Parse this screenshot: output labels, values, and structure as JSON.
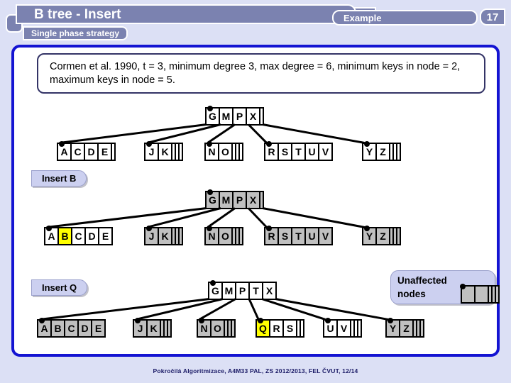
{
  "header": {
    "title": "B tree - Insert",
    "subtitle": "Single phase strategy",
    "section": "Example",
    "page_number": "17"
  },
  "callout": {
    "text": "Cormen et al. 1990, t = 3, minimum degree 3, max degree = 6, minimum keys in node = 2, maximum keys in node = 5."
  },
  "labels": {
    "insert_b": "Insert B",
    "insert_q": "Insert Q"
  },
  "legend": {
    "text": "Unaffected nodes"
  },
  "footer": {
    "text": "Pokročilá Algoritmizace, A4M33 PAL, ZS 2012/2013, FEL ČVUT,  12/14"
  },
  "colors": {
    "panel_border": "#1414d2",
    "header_fill": "#7b82b0",
    "page_bg": "#dce0f5",
    "highlight": "#ffff00",
    "unaffected": "#c0c0c0",
    "affected": "#ffffff"
  },
  "trees": [
    {
      "name": "initial-tree",
      "root": {
        "keys": [
          "G",
          "M",
          "P",
          "X"
        ],
        "capacity": 5,
        "fill": "white",
        "highlight": null
      },
      "children": [
        {
          "keys": [
            "A",
            "C",
            "D",
            "E"
          ],
          "capacity": 5,
          "fill": "white",
          "highlight": null
        },
        {
          "keys": [
            "J",
            "K"
          ],
          "capacity": 5,
          "fill": "white",
          "highlight": null
        },
        {
          "keys": [
            "N",
            "O"
          ],
          "capacity": 5,
          "fill": "white",
          "highlight": null
        },
        {
          "keys": [
            "R",
            "S",
            "T",
            "U",
            "V"
          ],
          "capacity": 5,
          "fill": "white",
          "highlight": null
        },
        {
          "keys": [
            "Y",
            "Z"
          ],
          "capacity": 5,
          "fill": "white",
          "highlight": null
        }
      ]
    },
    {
      "name": "after-insert-b",
      "root": {
        "keys": [
          "G",
          "M",
          "P",
          "X"
        ],
        "capacity": 5,
        "fill": "gray",
        "highlight": null
      },
      "children": [
        {
          "keys": [
            "A",
            "B",
            "C",
            "D",
            "E"
          ],
          "capacity": 5,
          "fill": "white",
          "highlight": "B"
        },
        {
          "keys": [
            "J",
            "K"
          ],
          "capacity": 5,
          "fill": "gray",
          "highlight": null
        },
        {
          "keys": [
            "N",
            "O"
          ],
          "capacity": 5,
          "fill": "gray",
          "highlight": null
        },
        {
          "keys": [
            "R",
            "S",
            "T",
            "U",
            "V"
          ],
          "capacity": 5,
          "fill": "gray",
          "highlight": null
        },
        {
          "keys": [
            "Y",
            "Z"
          ],
          "capacity": 5,
          "fill": "gray",
          "highlight": null
        }
      ]
    },
    {
      "name": "after-insert-q",
      "root": {
        "keys": [
          "G",
          "M",
          "P",
          "T",
          "X"
        ],
        "capacity": 5,
        "fill": "white",
        "highlight": null
      },
      "children": [
        {
          "keys": [
            "A",
            "B",
            "C",
            "D",
            "E"
          ],
          "capacity": 5,
          "fill": "gray",
          "highlight": null
        },
        {
          "keys": [
            "J",
            "K"
          ],
          "capacity": 5,
          "fill": "gray",
          "highlight": null
        },
        {
          "keys": [
            "N",
            "O"
          ],
          "capacity": 5,
          "fill": "gray",
          "highlight": null
        },
        {
          "keys": [
            "Q",
            "R",
            "S"
          ],
          "capacity": 5,
          "fill": "white",
          "highlight": "Q"
        },
        {
          "keys": [
            "U",
            "V"
          ],
          "capacity": 5,
          "fill": "white",
          "highlight": null
        },
        {
          "keys": [
            "Y",
            "Z"
          ],
          "capacity": 5,
          "fill": "gray",
          "highlight": null
        }
      ]
    }
  ]
}
